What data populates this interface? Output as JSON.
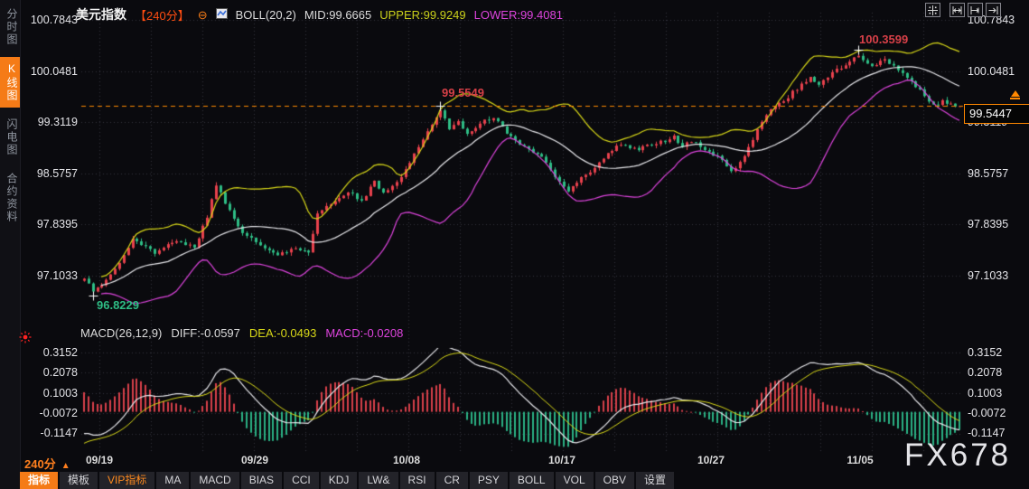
{
  "header": {
    "symbol": "美元指数",
    "period": "【240分】",
    "boll": "BOLL(20,2)",
    "mid": "MID:99.6665",
    "upper": "UPPER:99.9249",
    "lower": "LOWER:99.4081"
  },
  "icons": {
    "triangle_up": "▲",
    "collapse": "⊖"
  },
  "sidebar": {
    "items": [
      {
        "label": "分时图",
        "active": false
      },
      {
        "label": "K线图",
        "active": true
      },
      {
        "label": "闪电图",
        "active": false
      },
      {
        "label": "合约资料",
        "active": false
      }
    ]
  },
  "macd_header": {
    "title": "MACD(26,12,9)",
    "diff": "DIFF:-0.0597",
    "dea": "DEA:-0.0493",
    "macd": "MACD:-0.0208"
  },
  "annotations": {
    "high1": "99.5549",
    "high2": "100.3599",
    "low": "96.8229",
    "last_price": "99.5447"
  },
  "period_selector": {
    "label": "240分"
  },
  "watermark": {
    "text": "FX678"
  },
  "toolbar": {
    "items": [
      "指标",
      "模板",
      "VIP指标",
      "MA",
      "MACD",
      "BIAS",
      "CCI",
      "KDJ",
      "LW&",
      "RSI",
      "CR",
      "PSY",
      "BOLL",
      "VOL",
      "OBV",
      "设置"
    ]
  },
  "colors": {
    "accent_orange": "#f57b17",
    "candle_up": "#e8414d",
    "candle_down": "#2ebd85",
    "boll_upper": "#d8d818",
    "boll_mid": "#e8e8ec",
    "boll_lower": "#dd44dd",
    "price_line": "#ff8800",
    "hist_pos": "#d8404a",
    "hist_neg": "#2ab184"
  },
  "chart_data": {
    "type": "candlestick",
    "instrument": "美元指数",
    "interval": "240分",
    "n_candles": 200,
    "y_axis_main": [
      100.7843,
      100.0481,
      99.3119,
      98.5757,
      97.8395,
      97.1033
    ],
    "y_axis_macd": [
      0.3152,
      0.2078,
      0.1003,
      -0.0072,
      -0.1147
    ],
    "x_ticks": {
      "labels": [
        "09/19",
        "09/29",
        "10/08",
        "10/17",
        "10/27",
        "11/05"
      ],
      "indices": [
        3.5,
        38.8,
        73.3,
        108.6,
        142.5,
        176.4
      ]
    },
    "overlays": {
      "boll": {
        "window": 20,
        "k": 2,
        "mid": 99.6665,
        "upper": 99.9249,
        "lower": 99.4081
      }
    },
    "macd": {
      "fast": 26,
      "slow": 12,
      "signal": 9,
      "diff": -0.0597,
      "dea": -0.0493,
      "macd": -0.0208
    },
    "markers": {
      "low": {
        "index": 2,
        "price": 96.8229
      },
      "high1": {
        "index": 81,
        "price": 99.5549
      },
      "high2": {
        "index": 176,
        "price": 100.3599
      }
    },
    "last_close": 99.5447,
    "close_keyframes": [
      [
        0,
        97.08
      ],
      [
        2,
        96.88
      ],
      [
        5,
        97.02
      ],
      [
        8,
        97.3
      ],
      [
        11,
        97.62
      ],
      [
        13,
        97.55
      ],
      [
        16,
        97.42
      ],
      [
        19,
        97.55
      ],
      [
        22,
        97.6
      ],
      [
        25,
        97.5
      ],
      [
        28,
        97.95
      ],
      [
        30,
        98.42
      ],
      [
        32,
        98.15
      ],
      [
        36,
        97.72
      ],
      [
        40,
        97.55
      ],
      [
        44,
        97.42
      ],
      [
        48,
        97.5
      ],
      [
        51,
        97.45
      ],
      [
        53,
        98.0
      ],
      [
        56,
        98.15
      ],
      [
        60,
        98.32
      ],
      [
        63,
        98.18
      ],
      [
        66,
        98.45
      ],
      [
        68,
        98.3
      ],
      [
        72,
        98.52
      ],
      [
        76,
        98.95
      ],
      [
        79,
        99.3
      ],
      [
        81,
        99.5
      ],
      [
        83,
        99.22
      ],
      [
        85,
        99.33
      ],
      [
        87,
        99.12
      ],
      [
        90,
        99.3
      ],
      [
        93,
        99.38
      ],
      [
        96,
        99.15
      ],
      [
        100,
        98.95
      ],
      [
        104,
        98.8
      ],
      [
        108,
        98.45
      ],
      [
        110,
        98.3
      ],
      [
        112,
        98.45
      ],
      [
        114,
        98.55
      ],
      [
        118,
        98.8
      ],
      [
        122,
        99.0
      ],
      [
        126,
        98.92
      ],
      [
        129,
        99.0
      ],
      [
        132,
        99.05
      ],
      [
        134,
        99.12
      ],
      [
        136,
        98.95
      ],
      [
        138,
        99.05
      ],
      [
        141,
        98.9
      ],
      [
        144,
        98.82
      ],
      [
        147,
        98.6
      ],
      [
        149,
        98.72
      ],
      [
        151,
        98.95
      ],
      [
        153,
        99.2
      ],
      [
        155,
        99.42
      ],
      [
        157,
        99.55
      ],
      [
        159,
        99.62
      ],
      [
        162,
        99.8
      ],
      [
        165,
        99.95
      ],
      [
        167,
        99.85
      ],
      [
        170,
        100.02
      ],
      [
        173,
        100.15
      ],
      [
        176,
        100.28
      ],
      [
        179,
        100.12
      ],
      [
        182,
        100.2
      ],
      [
        185,
        100.08
      ],
      [
        188,
        99.9
      ],
      [
        191,
        99.7
      ],
      [
        193,
        99.55
      ],
      [
        195,
        99.62
      ],
      [
        197,
        99.56
      ],
      [
        199,
        99.5447
      ]
    ]
  }
}
